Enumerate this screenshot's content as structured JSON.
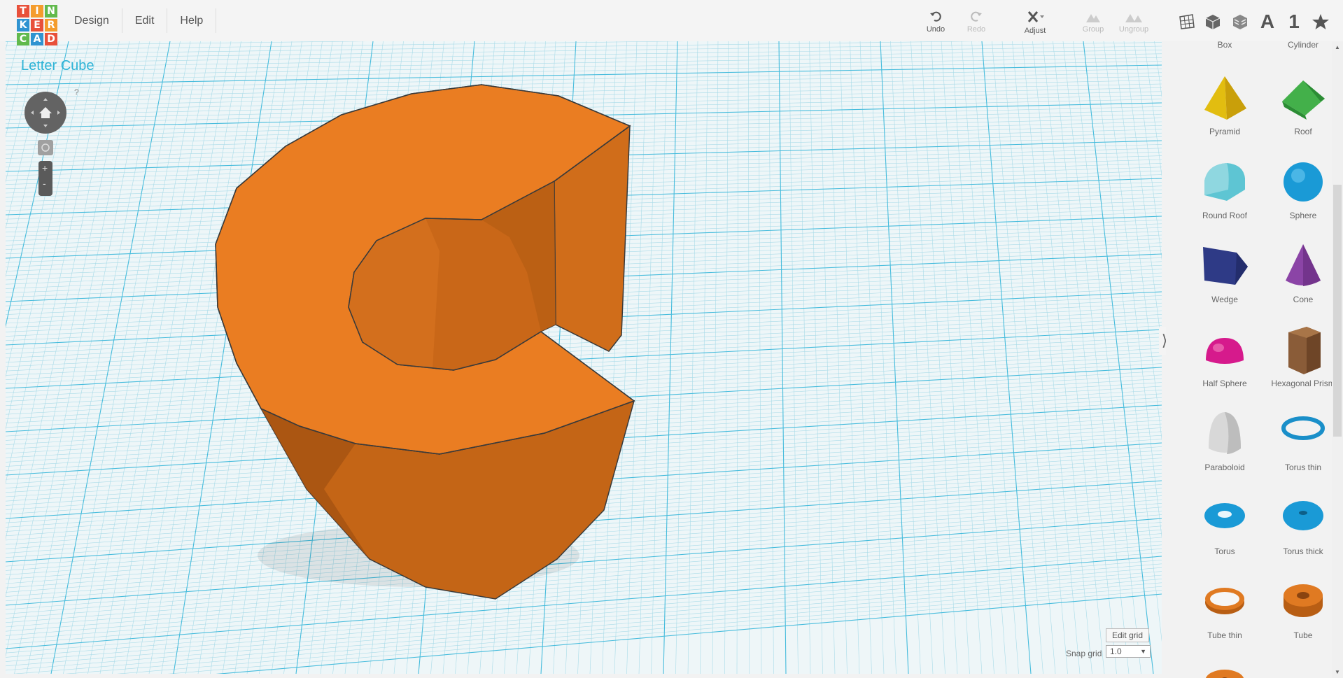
{
  "logo": {
    "letters": [
      "T",
      "I",
      "N",
      "K",
      "E",
      "R",
      "C",
      "A",
      "D"
    ],
    "colors": [
      "#e8503a",
      "#f49c2c",
      "#61b94c",
      "#2f93d1",
      "#e8503a",
      "#f49c2c",
      "#61b94c",
      "#2f93d1",
      "#e8503a"
    ]
  },
  "menu": [
    "Design",
    "Edit",
    "Help"
  ],
  "toolbar": {
    "undo": "Undo",
    "redo": "Redo",
    "adjust": "Adjust",
    "group": "Group",
    "ungroup": "Ungroup",
    "text_icon": "A",
    "number_icon": "1"
  },
  "design_title": "Letter Cube",
  "nav": {
    "help": "?",
    "zoom_in": "+",
    "zoom_out": "-"
  },
  "shapes": [
    {
      "label": "Box"
    },
    {
      "label": "Cylinder"
    },
    {
      "label": "Pyramid"
    },
    {
      "label": "Roof"
    },
    {
      "label": "Round Roof"
    },
    {
      "label": "Sphere"
    },
    {
      "label": "Wedge"
    },
    {
      "label": "Cone"
    },
    {
      "label": "Half Sphere"
    },
    {
      "label": "Hexagonal Prism"
    },
    {
      "label": "Paraboloid"
    },
    {
      "label": "Torus thin"
    },
    {
      "label": "Torus"
    },
    {
      "label": "Torus thick"
    },
    {
      "label": "Tube thin"
    },
    {
      "label": "Tube"
    }
  ],
  "grid": {
    "edit_grid": "Edit grid",
    "snap_label": "Snap grid",
    "snap_value": "1.0"
  },
  "colors": {
    "accent": "#2db3d6",
    "object": "#ea7d22",
    "grid_line": "#4cc0dc"
  }
}
